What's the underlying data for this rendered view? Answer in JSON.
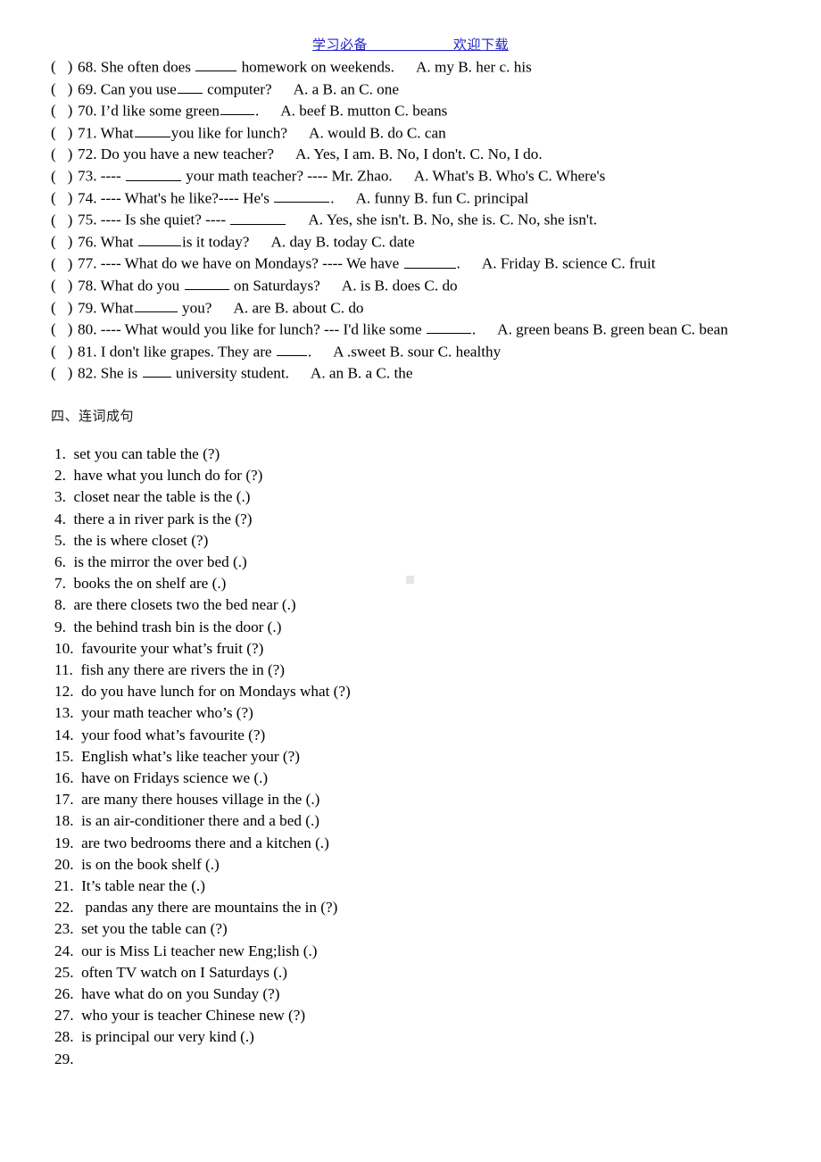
{
  "header": {
    "left_text": "学习必备",
    "separator": "＿＿＿＿＿＿",
    "right_text": "欢迎下载",
    "color": "#2222cc"
  },
  "multiple_choice": {
    "items": [
      {
        "marker": "(",
        "close": ")",
        "number": "68.",
        "text_before": "She often does ",
        "blank": true,
        "blank_w": 46,
        "text_after": " homework on weekends.",
        "options": "A. my   B. her    c. his"
      },
      {
        "marker": "(",
        "close": ")",
        "number": "69.",
        "text_before": "Can you use",
        "blank": true,
        "blank_w": 28,
        "text_after": " computer?",
        "options": "A. a   B. an    C. one"
      },
      {
        "marker": "(",
        "close": ")",
        "number": "70.",
        "text_before": "I’d like some green",
        "blank": true,
        "blank_w": 38,
        "text_after": ".",
        "options": "A. beef    B. mutton     C. beans"
      },
      {
        "marker": "(",
        "close": ")",
        "number": "71.",
        "text_before": "What",
        "blank": true,
        "blank_w": 40,
        "text_after": "you like for lunch?",
        "options": "A. would   B. do    C. can"
      },
      {
        "marker": "(",
        "close": ")",
        "number": "72.",
        "text_before": "Do you have a new teacher?",
        "blank": false,
        "blank_w": 0,
        "text_after": "",
        "options": "A. Yes, I am.    B. No, I don't.     C. No, I do."
      },
      {
        "marker": "(",
        "close": ")",
        "number": "73.",
        "text_before": "---- ",
        "blank": true,
        "blank_w": 62,
        "text_after": " your math teacher? ---- Mr. Zhao.",
        "options": "A. What's    B. Who's   C. Where's"
      },
      {
        "marker": "(",
        "close": ")",
        "number": "74.",
        "text_before": "---- What's he like?---- He's ",
        "blank": true,
        "blank_w": 62,
        "text_after": ".",
        "options": "A. funny   B. fun   C. principal"
      },
      {
        "marker": "(",
        "close": ")",
        "number": "75.",
        "text_before": "---- Is she quiet?   ---- ",
        "blank": true,
        "blank_w": 62,
        "text_after": "",
        "options": "A. Yes, she isn't.   B. No, she is.    C. No, she isn't."
      },
      {
        "marker": "(",
        "close": ")",
        "number": "76.",
        "text_before": "What ",
        "blank": true,
        "blank_w": 48,
        "text_after": "is it today?",
        "options": "A. day    B. today    C. date"
      },
      {
        "marker": "(",
        "close": ")",
        "number": "77.",
        "text_before": "---- What do we have on Mondays? ---- We have ",
        "blank": true,
        "blank_w": 58,
        "text_after": ".",
        "options": "A. Friday    B. science    C. fruit"
      },
      {
        "marker": "(",
        "close": ")",
        "number": "78.",
        "text_before": "What do you ",
        "blank": true,
        "blank_w": 50,
        "text_after": " on Saturdays?",
        "options": "A. is    B. does    C. do"
      },
      {
        "marker": "(",
        "close": ")",
        "number": "79.",
        "text_before": "What",
        "blank": true,
        "blank_w": 48,
        "text_after": " you?",
        "options": "A. are    B. about    C. do"
      },
      {
        "marker": "(",
        "close": ")",
        "number": "80.",
        "text_before": "---- What would you like for lunch? --- I'd like some ",
        "blank": true,
        "blank_w": 50,
        "text_after": ".",
        "options": "A. green beans    B. green bean C. bean"
      },
      {
        "marker": "(",
        "close": ")",
        "number": "81.",
        "text_before": "I don't like grapes. They are ",
        "blank": true,
        "blank_w": 34,
        "text_after": ".",
        "options": "A .sweet    B. sour    C. healthy"
      },
      {
        "marker": "(",
        "close": ")",
        "number": "82.",
        "text_before": "She is ",
        "blank": true,
        "blank_w": 32,
        "text_after": " university student.",
        "options": "A. an    B. a    C. the"
      }
    ]
  },
  "section": {
    "heading": "四、连词成句"
  },
  "word_order": {
    "items": [
      {
        "num": "1.",
        "text": "set   you   can   table    the   (?)"
      },
      {
        "num": "2.",
        "text": "have      what      you     lunch     do  for (?)"
      },
      {
        "num": "3.",
        "text": "closet     near      the       table      is     the (.)"
      },
      {
        "num": "4.",
        "text": "there   a   in    river    park    is   the    (?)"
      },
      {
        "num": "5.",
        "text": "the    is      where    closet      (?)"
      },
      {
        "num": "6.",
        "text": "is   the   mirror    the   over    bed (.)"
      },
      {
        "num": "7.",
        "text": "books    the   on   shelf    are   (.)"
      },
      {
        "num": "8.",
        "text": "are   there    closets    two    the  bed    near   (.)"
      },
      {
        "num": "9.",
        "text": "the     behind     trash bin    is   the    door   (.)"
      },
      {
        "num": "10.",
        "text": "favourite    your    what’s   fruit   (?)"
      },
      {
        "num": "11.",
        "text": "fish   any    there    are   rivers    the   in   (?)"
      },
      {
        "num": "12.",
        "text": "do you  have  lunch   for   on   Mondays   what  (?)"
      },
      {
        "num": "13.",
        "text": "your    math    teacher     who’s (?)"
      },
      {
        "num": "14.",
        "text": "your    food    what’s    favourite    (?)"
      },
      {
        "num": "15.",
        "text": "English    what’s    like    teacher    your   (?)"
      },
      {
        "num": "16.",
        "text": "have   on   Fridays   science   we (.)"
      },
      {
        "num": "17.",
        "text": "are  many   there   houses   village  in   the   (.)"
      },
      {
        "num": "18.",
        "text": "is   an  air-conditioner  there  and   a bed (.)"
      },
      {
        "num": "19.",
        "text": "are   two   bedrooms   there  and  a  kitchen (.)"
      },
      {
        "num": "20.",
        "text": "is   on the   book   shelf  (.)"
      },
      {
        "num": "21.",
        "text": "It’s   table  near   the (.)"
      },
      {
        "num": "22.",
        "text": " pandas   any   there   are   mountains   the  in (?)"
      },
      {
        "num": "23.",
        "text": "set   you   the   table   can  (?)"
      },
      {
        "num": "24.",
        "text": "our  is  Miss Li   teacher   new    Eng;lish (.)"
      },
      {
        "num": "25.",
        "text": "often   TV   watch   on   I   Saturdays (.)"
      },
      {
        "num": "26.",
        "text": "have what do on you Sunday (?)"
      },
      {
        "num": "27.",
        "text": "who your is teacher  Chinese  new (?)"
      },
      {
        "num": "28.",
        "text": "is principal  our very kind (.)"
      },
      {
        "num": "29.",
        "text": ""
      }
    ]
  }
}
